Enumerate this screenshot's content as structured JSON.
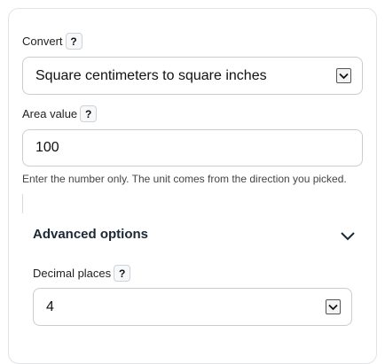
{
  "convert": {
    "label": "Convert",
    "help": "?",
    "selected": "Square centimeters to square inches"
  },
  "area": {
    "label": "Area value",
    "help": "?",
    "value": "100",
    "hint": "Enter the number only. The unit comes from the direction you picked."
  },
  "advanced": {
    "title": "Advanced options",
    "expand_icon": "chevron-down-icon"
  },
  "decimals": {
    "label": "Decimal places",
    "help": "?",
    "selected": "4"
  }
}
